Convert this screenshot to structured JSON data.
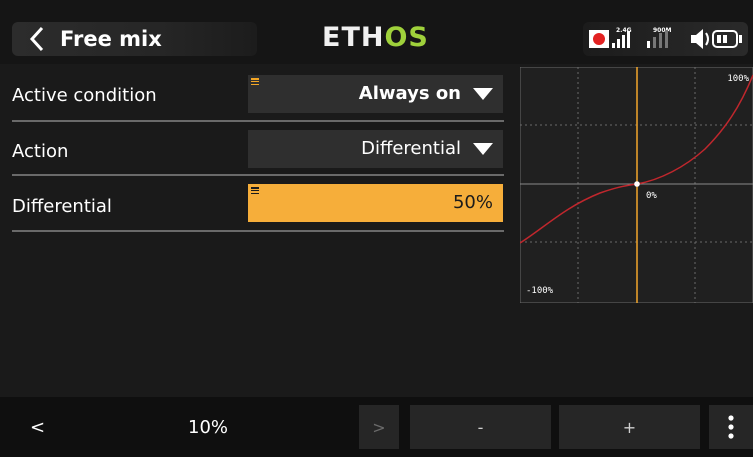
{
  "header": {
    "title": "Free mix",
    "logo_part1": "ETH",
    "logo_part2": "OS",
    "status": {
      "band1": "2.4G",
      "band2": "900M"
    }
  },
  "rows": [
    {
      "label": "Active condition",
      "value": "Always on"
    },
    {
      "label": "Action",
      "value": "Differential"
    },
    {
      "label": "Differential",
      "value": "50%"
    }
  ],
  "graph": {
    "label_top_right": "100%",
    "label_center": "0%",
    "label_bottom_left": "-100%",
    "curve_color": "#c0272d",
    "cursor_color": "#f2a62a"
  },
  "toolbar": {
    "prev_label": "<",
    "step_value": "10%",
    "next_label": ">",
    "minus_label": "-",
    "plus_label": "+",
    "more_icon": "more-vertical-icon"
  }
}
